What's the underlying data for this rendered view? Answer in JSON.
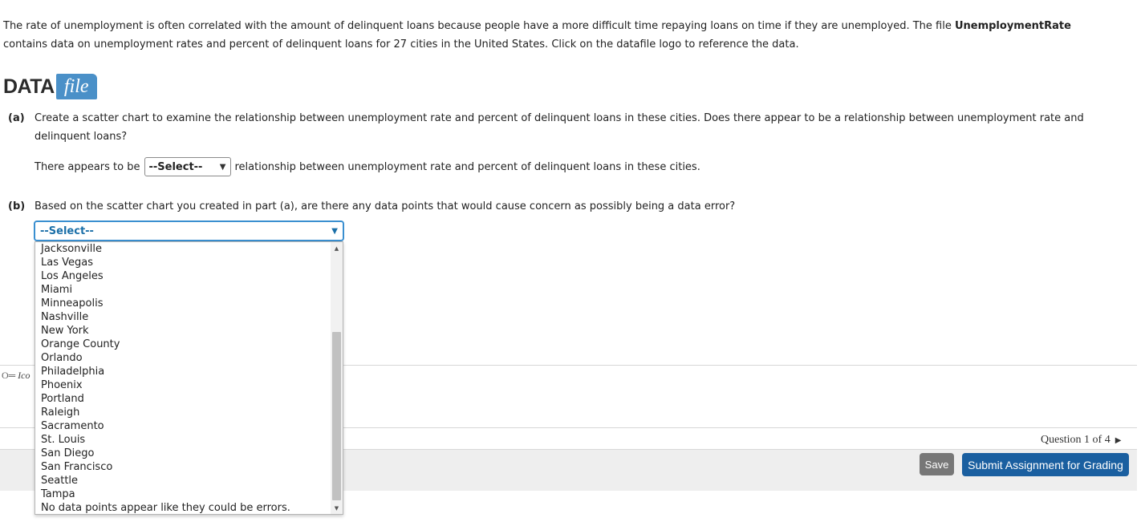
{
  "intro": {
    "part1": "The rate of unemployment is often correlated with the amount of delinquent loans because people have a more difficult time repaying loans on time if they are unemployed. The file ",
    "filename": "UnemploymentRate",
    "part2": " contains data on unemployment rates and percent of delinquent loans for 27 cities in the United States. Click on the datafile logo to reference the data."
  },
  "logo": {
    "data_text": "DATA",
    "file_text": "file"
  },
  "part_a": {
    "label": "(a)",
    "question": "Create a scatter chart to examine the relationship between unemployment rate and percent of delinquent loans in these cities. Does there appear to be a relationship between unemployment rate and delinquent loans?",
    "answer_prefix": "There appears to be",
    "select_value": "--Select--",
    "answer_suffix": "relationship between unemployment rate and percent of delinquent loans in these cities."
  },
  "part_b": {
    "label": "(b)",
    "question": "Based on the scatter chart you created in part (a), are there any data points that would cause concern as possibly being a data error?",
    "select_value": "--Select--",
    "options": [
      "Jacksonville",
      "Las Vegas",
      "Los Angeles",
      "Miami",
      "Minneapolis",
      "Nashville",
      "New York",
      "Orange County",
      "Orlando",
      "Philadelphia",
      "Phoenix",
      "Portland",
      "Raleigh",
      "Sacramento",
      "St. Louis",
      "San Diego",
      "San Francisco",
      "Seattle",
      "Tampa",
      "No data points appear like they could be errors."
    ]
  },
  "key_label": "Ico",
  "nav": {
    "question_counter": "Question 1 of 4"
  },
  "footer": {
    "save_label": "Save",
    "submit_label": "Submit Assignment for Grading"
  },
  "colors": {
    "submit": "#1a5fa0",
    "save": "#777777",
    "focus": "#3a8fd0",
    "logo_file": "#4a90c8"
  }
}
